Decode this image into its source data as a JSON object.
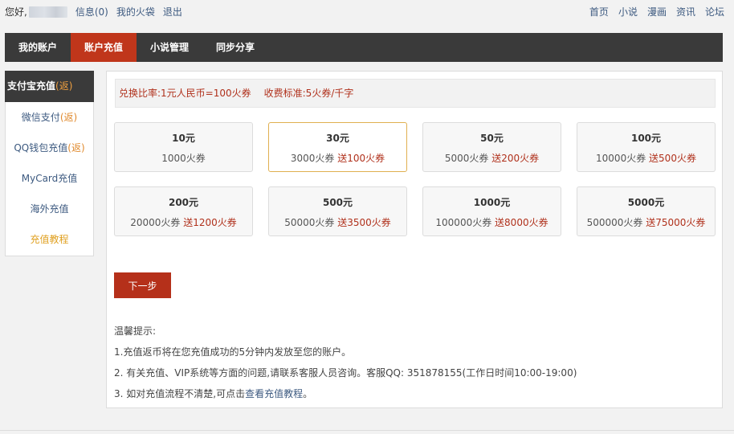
{
  "topbar": {
    "greeting": "您好,",
    "links": [
      "信息(0)",
      "我的火袋",
      "退出"
    ],
    "right_links": [
      "首页",
      "小说",
      "漫画",
      "资讯",
      "论坛"
    ]
  },
  "nav": {
    "tabs": [
      "我的账户",
      "账户充值",
      "小说管理",
      "同步分享"
    ],
    "active": "账户充值"
  },
  "sidebar": {
    "items": [
      {
        "label": "支付宝充值",
        "suffix": "(返)"
      },
      {
        "label": "微信支付",
        "suffix": "(返)"
      },
      {
        "label": "QQ钱包充值",
        "suffix": "(返)"
      },
      {
        "label": "MyCard充值",
        "suffix": ""
      },
      {
        "label": "海外充值",
        "suffix": ""
      },
      {
        "label": "充值教程",
        "suffix": ""
      }
    ],
    "active_index": 0
  },
  "rate": {
    "ratio": "兑换比率:1元人民币=100火券",
    "standard": "收费标准:5火券/千字"
  },
  "packages": [
    {
      "amount": "10元",
      "coins": "1000火券",
      "bonus": ""
    },
    {
      "amount": "30元",
      "coins": "3000火券",
      "bonus": "送100火券"
    },
    {
      "amount": "50元",
      "coins": "5000火券",
      "bonus": "送200火券"
    },
    {
      "amount": "100元",
      "coins": "10000火券",
      "bonus": "送500火券"
    },
    {
      "amount": "200元",
      "coins": "20000火券",
      "bonus": "送1200火券"
    },
    {
      "amount": "500元",
      "coins": "50000火券",
      "bonus": "送3500火券"
    },
    {
      "amount": "1000元",
      "coins": "100000火券",
      "bonus": "送8000火券"
    },
    {
      "amount": "5000元",
      "coins": "500000火券",
      "bonus": "送75000火券"
    }
  ],
  "selected_package_index": 1,
  "next_button": "下一步",
  "tips": {
    "title": "温馨提示:",
    "line1": "1.充值返币将在您充值成功的5分钟内发放至您的账户。",
    "line2": "2. 有关充值、VIP系统等方面的问题,请联系客服人员咨询。客服QQ: 351878155(工作日时间10:00-19:00)",
    "line3_prefix": "3. 如对充值流程不清楚,可点击",
    "line3_link": "查看充值教程",
    "line3_suffix": "。"
  },
  "colors": {
    "accent": "#c0361b",
    "nav_bg": "#3a3a3a",
    "bonus": "#b0311c",
    "link": "#3d5a80",
    "selected_border": "#e0b050"
  }
}
